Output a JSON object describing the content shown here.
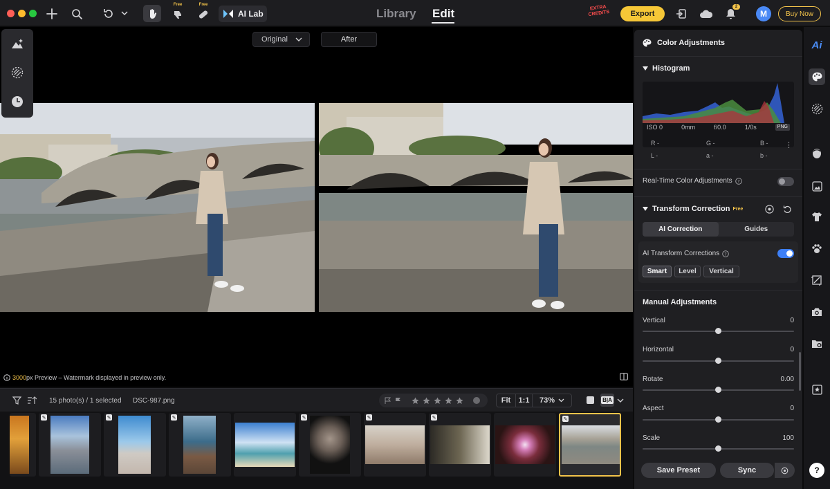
{
  "titlebar": {
    "ailab_label": "AI Lab",
    "free_tag_1": "Free",
    "free_tag_2": "Free",
    "tab_library": "Library",
    "tab_edit": "Edit",
    "extra_credits": "EXTRA CREDITS",
    "export_label": "Export",
    "notif_count": "2",
    "avatar_letter": "M",
    "buy_now": "Buy Now"
  },
  "canvas": {
    "view_select": "Original",
    "after_label": "After",
    "preview_px": "3000",
    "preview_note": "px Preview – Watermark displayed in preview only."
  },
  "filmbar": {
    "count_text": "15 photo(s) / 1 selected",
    "filename": "DSC-987.png",
    "zoom_fit": "Fit",
    "zoom_11": "1:1",
    "zoom_pct": "73%",
    "ba_label": "B|A"
  },
  "panel": {
    "title": "Color Adjustments",
    "histogram_title": "Histogram",
    "iso": "ISO 0",
    "focal": "0mm",
    "aperture": "f/0.0",
    "shutter": "1/0s",
    "format": "PNG",
    "r": "R -",
    "g": "G -",
    "b": "B -",
    "l": "L -",
    "a": "a -",
    "b2": "b -",
    "realtime_label": "Real-Time Color Adjustments",
    "transform_title": "Transform Correction",
    "transform_free": "Free",
    "seg_ai": "AI Correction",
    "seg_guides": "Guides",
    "ai_transform_label": "AI Transform Corrections",
    "pill_smart": "Smart",
    "pill_level": "Level",
    "pill_vertical": "Vertical",
    "manual_title": "Manual Adjustments",
    "sliders": [
      {
        "label": "Vertical",
        "value": "0"
      },
      {
        "label": "Horizontal",
        "value": "0"
      },
      {
        "label": "Rotate",
        "value": "0.00"
      },
      {
        "label": "Aspect",
        "value": "0"
      },
      {
        "label": "Scale",
        "value": "100"
      }
    ],
    "save_preset": "Save Preset",
    "sync": "Sync"
  },
  "help": "?",
  "colors": {
    "accent": "#f6c737",
    "toggle_on": "#3d7ff6",
    "avatar": "#4a89f5"
  }
}
